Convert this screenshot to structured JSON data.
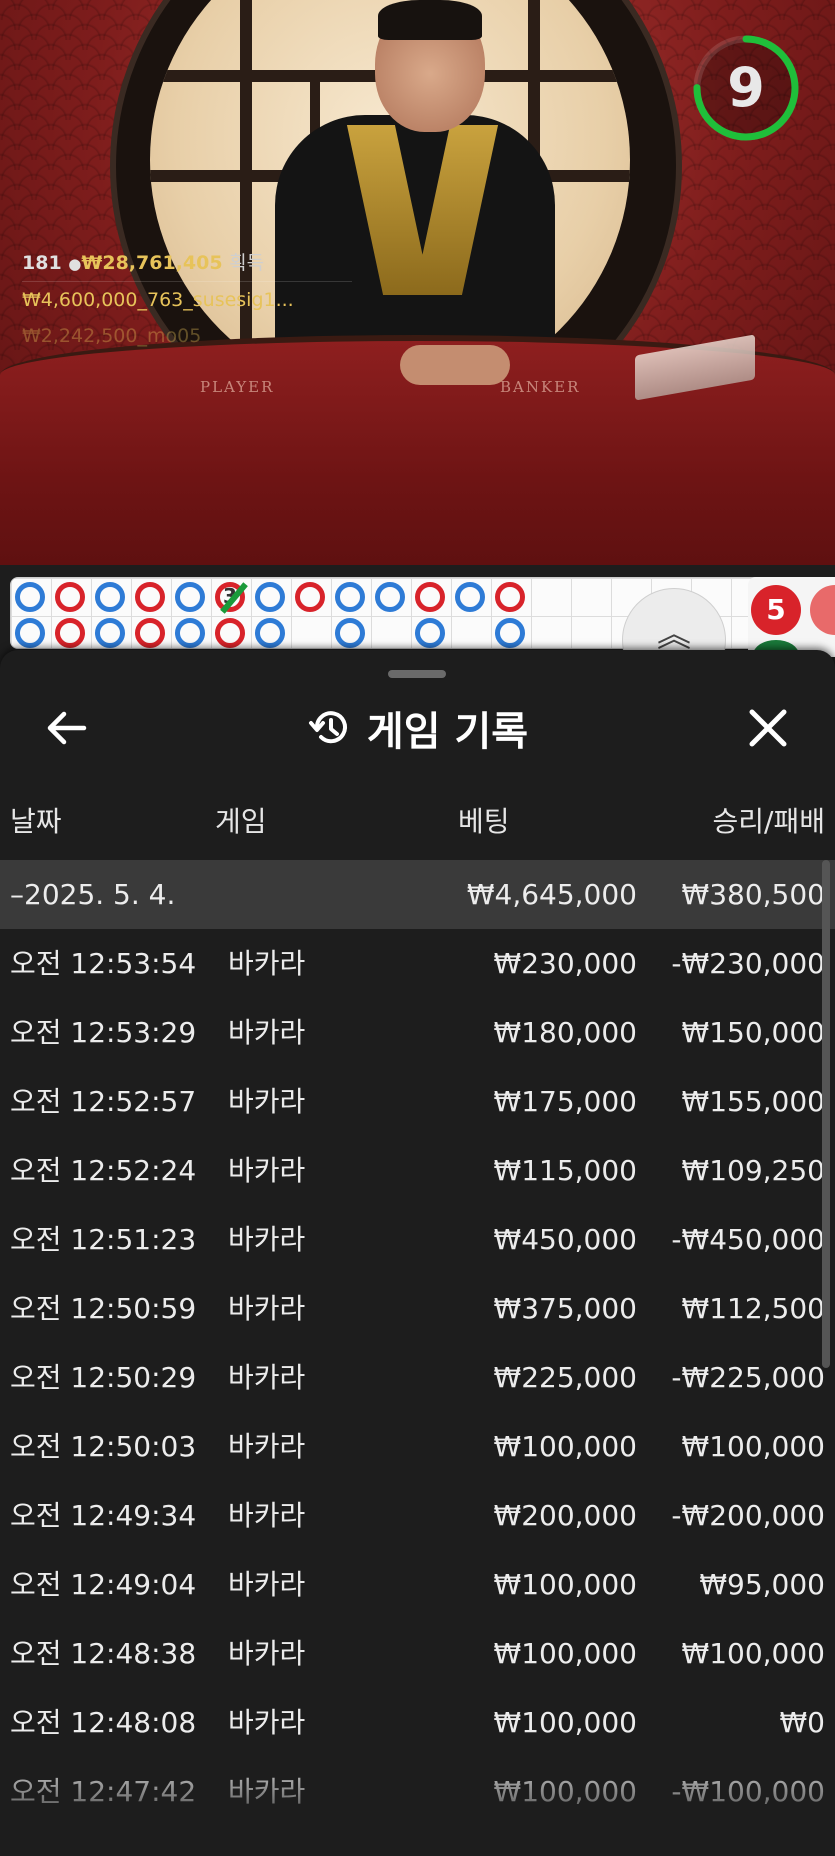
{
  "video": {
    "table_labels": [
      "PLAYER",
      "BANKER"
    ],
    "timer": {
      "value": "9",
      "fraction": 0.75
    },
    "chat": {
      "win_count": "181",
      "win_amount": "₩28,761,405",
      "win_suffix": "획득",
      "line2": "₩4,600,000_763_susesig1...",
      "line3": "₩2,242,500_mo05"
    }
  },
  "roadmap": {
    "marker_number": "3",
    "up_arrow": "︽",
    "stat_red": "5",
    "row1": [
      "B",
      "R",
      "B",
      "R",
      "B",
      "R",
      "B",
      "R",
      "B",
      "B",
      "R",
      "B",
      "R"
    ],
    "row2": [
      "B",
      "R",
      "B",
      "R",
      "B",
      "R",
      "B",
      "",
      "B",
      "",
      "B",
      "",
      "B"
    ]
  },
  "history": {
    "title": "게임 기록",
    "columns": {
      "date": "날짜",
      "game": "게임",
      "bet": "베팅",
      "pl": "승리/패배"
    },
    "date_row": {
      "date": "–2025. 5. 4.",
      "bet": "₩4,645,000",
      "pl": "₩380,500"
    },
    "rows": [
      {
        "time": "오전 12:53:54",
        "game": "바카라",
        "bet": "₩230,000",
        "pl": "-₩230,000"
      },
      {
        "time": "오전 12:53:29",
        "game": "바카라",
        "bet": "₩180,000",
        "pl": "₩150,000"
      },
      {
        "time": "오전 12:52:57",
        "game": "바카라",
        "bet": "₩175,000",
        "pl": "₩155,000"
      },
      {
        "time": "오전 12:52:24",
        "game": "바카라",
        "bet": "₩115,000",
        "pl": "₩109,250"
      },
      {
        "time": "오전 12:51:23",
        "game": "바카라",
        "bet": "₩450,000",
        "pl": "-₩450,000"
      },
      {
        "time": "오전 12:50:59",
        "game": "바카라",
        "bet": "₩375,000",
        "pl": "₩112,500"
      },
      {
        "time": "오전 12:50:29",
        "game": "바카라",
        "bet": "₩225,000",
        "pl": "-₩225,000"
      },
      {
        "time": "오전 12:50:03",
        "game": "바카라",
        "bet": "₩100,000",
        "pl": "₩100,000"
      },
      {
        "time": "오전 12:49:34",
        "game": "바카라",
        "bet": "₩200,000",
        "pl": "-₩200,000"
      },
      {
        "time": "오전 12:49:04",
        "game": "바카라",
        "bet": "₩100,000",
        "pl": "₩95,000"
      },
      {
        "time": "오전 12:48:38",
        "game": "바카라",
        "bet": "₩100,000",
        "pl": "₩100,000"
      },
      {
        "time": "오전 12:48:08",
        "game": "바카라",
        "bet": "₩100,000",
        "pl": "₩0"
      },
      {
        "time": "오전 12:47:42",
        "game": "바카라",
        "bet": "₩100,000",
        "pl": "-₩100,000"
      }
    ]
  },
  "colors": {
    "panel_bg": "#1d1d1d",
    "date_row_bg": "#3a3a3a",
    "banker_red": "#d8232a",
    "player_blue": "#2e7bd6",
    "timer_green": "#1fbf3a",
    "gold": "#e7c35a"
  }
}
